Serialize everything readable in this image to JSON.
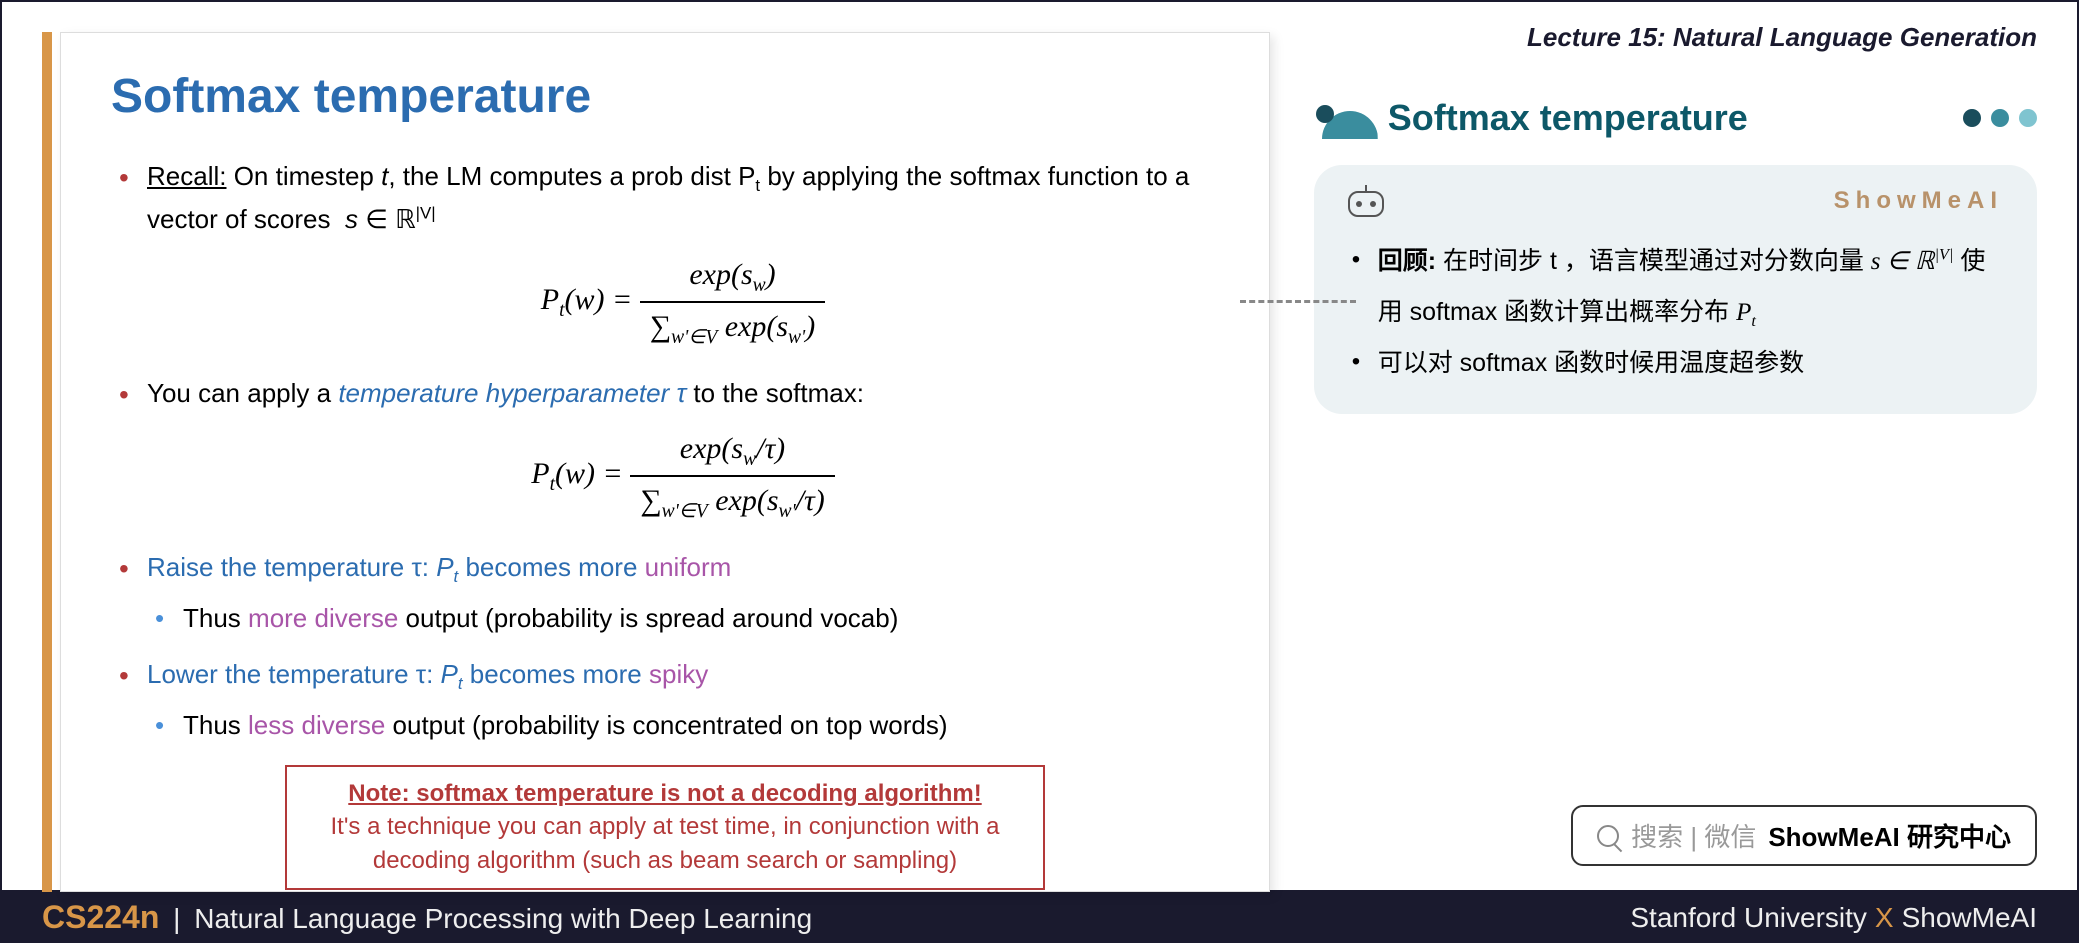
{
  "header": {
    "lecture_label": "Lecture 15: Natural Language Generation"
  },
  "slide": {
    "title": "Softmax temperature",
    "bullet1_prefix": "Recall:",
    "bullet1_text": " On timestep t, the LM computes a prob dist Pₜ by applying the softmax function to a vector of scores  s ∈ ℝ|V|",
    "formula1_lhs": "Pₜ(w) = ",
    "formula1_num": "exp(s_w)",
    "formula1_den": "∑_{w'∈V} exp(s_{w'})",
    "bullet2_a": "You can apply a ",
    "bullet2_b": "temperature hyperparameter τ",
    "bullet2_c": " to the softmax:",
    "formula2_lhs": "Pₜ(w) = ",
    "formula2_num": "exp(s_w/τ)",
    "formula2_den": "∑_{w'∈V} exp(s_{w'}/τ)",
    "bullet3_a": "Raise the temperature τ: Pₜ becomes more ",
    "bullet3_b": "uniform",
    "bullet3_sub_a": "Thus ",
    "bullet3_sub_b": "more diverse",
    "bullet3_sub_c": " output (probability is spread around vocab)",
    "bullet4_a": "Lower the temperature τ: Pₜ becomes more ",
    "bullet4_b": "spiky",
    "bullet4_sub_a": "Thus ",
    "bullet4_sub_b": "less diverse",
    "bullet4_sub_c": " output (probability is concentrated on top words)",
    "note_title": "Note: softmax temperature is not a decoding algorithm!",
    "note_body": "It's a technique you can apply at test time, in conjunction with a decoding algorithm (such as beam search or sampling)"
  },
  "sidebar": {
    "topic_title": "Softmax temperature",
    "brand": "ShowMeAI",
    "items": [
      "回顾: 在时间步 t ，语言模型通过对分数向量 s ∈ ℝ|V| 使用 softmax 函数计算出概率分布 Pₜ",
      "可以对 softmax 函数时候用温度超参数"
    ]
  },
  "search": {
    "placeholder": "搜索 | 微信",
    "bold_text": "ShowMeAI 研究中心"
  },
  "footer": {
    "course_code": "CS224n",
    "course_title": "Natural Language Processing with Deep Learning",
    "university": "Stanford University",
    "partner": "ShowMeAI"
  }
}
